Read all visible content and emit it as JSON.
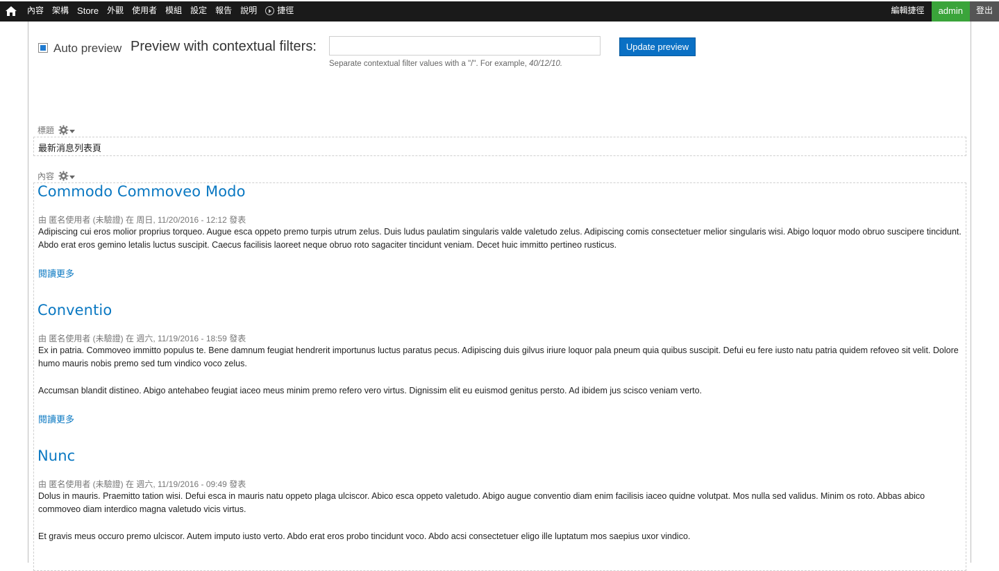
{
  "toolbar": {
    "menu": [
      "內容",
      "架構",
      "Store",
      "外觀",
      "使用者",
      "模組",
      "設定",
      "報告",
      "說明"
    ],
    "shortcuts_label": "捷徑",
    "edit_shortcuts": "編輯捷徑",
    "user": "admin",
    "logout": "登出"
  },
  "preview": {
    "auto_preview_label": "Auto preview",
    "auto_preview_checked": true,
    "contextual_label": "Preview with contextual filters:",
    "args_value": "",
    "help_prefix": "Separate contextual filter values with a \"/\". For example, ",
    "help_example": "40/12/10.",
    "update_button": "Update preview"
  },
  "title_section": {
    "label": "標題",
    "value": "最新消息列表頁"
  },
  "content_section": {
    "label": "內容",
    "articles": [
      {
        "title": "Commodo Commoveo Modo",
        "meta": "由 匿名使用者 (未驗證) 在 周日, 11/20/2016 - 12:12 發表",
        "paragraphs": [
          "Adipiscing cui eros molior proprius torqueo. Augue esca oppeto premo turpis utrum zelus. Duis ludus paulatim singularis valde valetudo zelus. Adipiscing comis consectetuer melior singularis wisi. Abigo loquor modo obruo suscipere tincidunt. Abdo erat eros gemino letalis luctus suscipit. Caecus facilisis laoreet neque obruo roto sagaciter tincidunt veniam. Decet huic immitto pertineo rusticus."
        ],
        "read_more": "閱讀更多"
      },
      {
        "title": "Conventio",
        "meta": "由 匿名使用者 (未驗證) 在 週六, 11/19/2016 - 18:59 發表",
        "paragraphs": [
          "Ex in patria. Commoveo immitto populus te. Bene damnum feugiat hendrerit importunus luctus paratus pecus. Adipiscing duis gilvus iriure loquor pala pneum quia quibus suscipit. Defui eu fere iusto natu patria quidem refoveo sit velit. Dolore humo mauris nobis premo sed tum vindico voco zelus.",
          "Accumsan blandit distineo. Abigo antehabeo feugiat iaceo meus minim premo refero vero virtus. Dignissim elit eu euismod genitus persto. Ad ibidem jus scisco veniam verto."
        ],
        "read_more": "閱讀更多"
      },
      {
        "title": "Nunc",
        "meta": "由 匿名使用者 (未驗證) 在 週六, 11/19/2016 - 09:49 發表",
        "paragraphs": [
          "Dolus in mauris. Praemitto tation wisi. Defui esca in mauris natu oppeto plaga ulciscor. Abico esca oppeto valetudo. Abigo augue conventio diam enim facilisis iaceo quidne volutpat. Mos nulla sed validus. Minim os roto. Abbas abico commoveo diam interdico magna valetudo vicis virtus.",
          "Et gravis meus occuro premo ulciscor. Autem imputo iusto verto. Abdo erat eros probo tincidunt voco. Abdo acsi consectetuer eligo ille luptatum mos saepius uxor vindico."
        ]
      }
    ]
  },
  "colors": {
    "toolbar_bg": "#1a1a1a",
    "user_bg": "#3aa43a",
    "link": "#0a78c2",
    "button": "#0a70c4"
  }
}
